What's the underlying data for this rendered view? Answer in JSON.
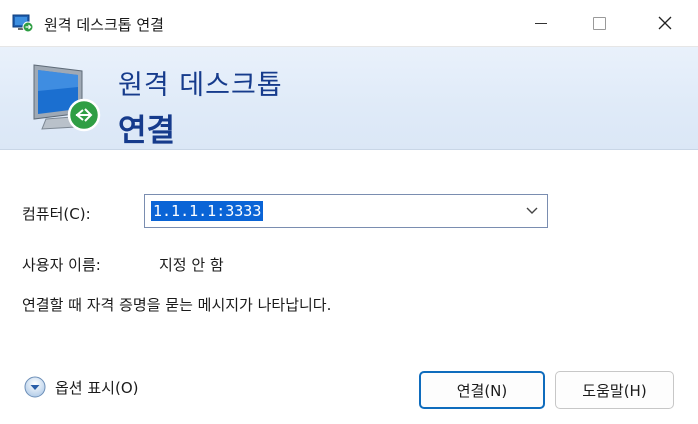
{
  "window": {
    "title": "원격 데스크톱 연결",
    "app_icon": "remote-desktop-icon",
    "controls": [
      "minimize-icon",
      "maximize-icon",
      "close-icon"
    ]
  },
  "banner": {
    "line1": "원격 데스크톱",
    "line2": "연결",
    "icon": "remote-desktop-monitor-icon"
  },
  "form": {
    "computer_label": "컴퓨터(C):",
    "computer_value": "1.1.1.1:3333",
    "user_label": "사용자 이름:",
    "user_value": "지정 안 함",
    "info": "연결할 때 자격 증명을 묻는 메시지가 나타납니다."
  },
  "footer": {
    "options_label": "옵션 표시(O)",
    "options_icon": "expand-down-circle-icon",
    "connect_label": "연결(N)",
    "help_label": "도움말(H)"
  },
  "colors": {
    "banner_text": "#163b8c",
    "selection": "#0a64d6",
    "primary_border": "#0f6cbd"
  }
}
